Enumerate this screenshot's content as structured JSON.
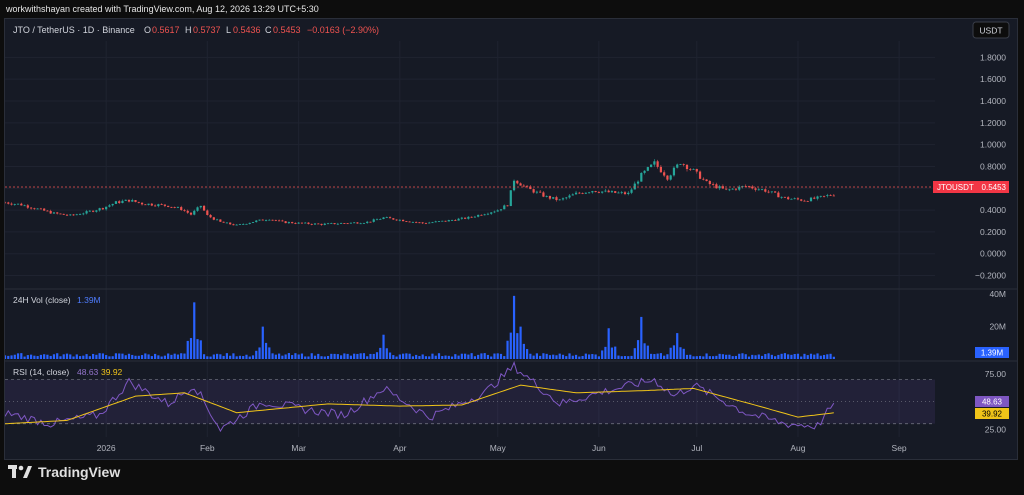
{
  "credit": "workwithshayan created with TradingView.com, Aug 12, 2026 13:29 UTC+5:30",
  "header": {
    "symbol": "JTO / TetherUS · 1D · Binance",
    "o_label": "O",
    "o": "0.5617",
    "h_label": "H",
    "h": "0.5737",
    "l_label": "L",
    "l": "0.5436",
    "c_label": "C",
    "c": "0.5453",
    "change": "−0.0163 (−2.90%)"
  },
  "currency_button": "USDT",
  "volume_pane": {
    "label": "24H Vol (close)",
    "value": "1.39M",
    "badge": "1.39M"
  },
  "rsi_pane": {
    "label": "RSI (14, close)",
    "rsi": "48.63",
    "ma": "39.92"
  },
  "price_badge": {
    "name": "JTOUSDT",
    "value": "0.5453"
  },
  "footer": {
    "brand": "TradingView"
  },
  "colors": {
    "up": "#26a69a",
    "down": "#ef5350",
    "volume": "#2962ff",
    "rsi": "#7e57c2",
    "rsi_ma": "#f0c419",
    "badge_red": "#f23645"
  },
  "chart_data": [
    {
      "type": "candlestick",
      "title": "JTO / TetherUS · 1D · Binance",
      "y_ticks": [
        "1.8000",
        "1.6000",
        "1.4000",
        "1.2000",
        "1.0000",
        "0.8000",
        "0.6000",
        "0.4000",
        "0.2000",
        "0.0000",
        "−0.2000"
      ],
      "x_ticks": [
        {
          "label": "2026",
          "date": "2026-01-01"
        },
        {
          "label": "Feb",
          "date": "2026-02-01"
        },
        {
          "label": "Mar",
          "date": "2026-03-01"
        },
        {
          "label": "Apr",
          "date": "2026-04-01"
        },
        {
          "label": "May",
          "date": "2026-05-01"
        },
        {
          "label": "Jun",
          "date": "2026-06-01"
        },
        {
          "label": "Jul",
          "date": "2026-07-01"
        },
        {
          "label": "Aug",
          "date": "2026-08-01"
        },
        {
          "label": "Sep",
          "date": "2026-09-01"
        }
      ],
      "ylim": [
        -0.25,
        1.95
      ],
      "date_range": [
        "2025-12-01",
        "2026-08-12"
      ],
      "close_points": [
        [
          "2025-12-01",
          0.47
        ],
        [
          "2025-12-06",
          0.45
        ],
        [
          "2025-12-11",
          0.41
        ],
        [
          "2025-12-16",
          0.37
        ],
        [
          "2025-12-21",
          0.35
        ],
        [
          "2025-12-26",
          0.38
        ],
        [
          "2025-12-31",
          0.42
        ],
        [
          "2026-01-04",
          0.47
        ],
        [
          "2026-01-08",
          0.49
        ],
        [
          "2026-01-12",
          0.46
        ],
        [
          "2026-01-16",
          0.45
        ],
        [
          "2026-01-20",
          0.44
        ],
        [
          "2026-01-24",
          0.41
        ],
        [
          "2026-01-27",
          0.36
        ],
        [
          "2026-01-30",
          0.44
        ],
        [
          "2026-02-01",
          0.35
        ],
        [
          "2026-02-05",
          0.29
        ],
        [
          "2026-02-10",
          0.26
        ],
        [
          "2026-02-16",
          0.3
        ],
        [
          "2026-02-20",
          0.32
        ],
        [
          "2026-02-24",
          0.29
        ],
        [
          "2026-03-01",
          0.28
        ],
        [
          "2026-03-08",
          0.27
        ],
        [
          "2026-03-15",
          0.28
        ],
        [
          "2026-03-22",
          0.29
        ],
        [
          "2026-03-27",
          0.33
        ],
        [
          "2026-04-01",
          0.31
        ],
        [
          "2026-04-08",
          0.28
        ],
        [
          "2026-04-15",
          0.3
        ],
        [
          "2026-04-22",
          0.33
        ],
        [
          "2026-04-27",
          0.37
        ],
        [
          "2026-05-01",
          0.4
        ],
        [
          "2026-05-04",
          0.45
        ],
        [
          "2026-05-06",
          0.68
        ],
        [
          "2026-05-10",
          0.6
        ],
        [
          "2026-05-16",
          0.52
        ],
        [
          "2026-05-20",
          0.49
        ],
        [
          "2026-05-25",
          0.55
        ],
        [
          "2026-05-30",
          0.58
        ],
        [
          "2026-06-05",
          0.56
        ],
        [
          "2026-06-10",
          0.55
        ],
        [
          "2026-06-14",
          0.72
        ],
        [
          "2026-06-18",
          0.83
        ],
        [
          "2026-06-22",
          0.7
        ],
        [
          "2026-06-26",
          0.84
        ],
        [
          "2026-06-30",
          0.76
        ],
        [
          "2026-07-04",
          0.65
        ],
        [
          "2026-07-10",
          0.58
        ],
        [
          "2026-07-16",
          0.62
        ],
        [
          "2026-07-22",
          0.58
        ],
        [
          "2026-07-28",
          0.51
        ],
        [
          "2026-08-03",
          0.49
        ],
        [
          "2026-08-07",
          0.51
        ],
        [
          "2026-08-12",
          0.5453
        ]
      ]
    },
    {
      "type": "bar",
      "title": "24H Vol (close)",
      "y_ticks": [
        "40M",
        "20M"
      ],
      "ylim": [
        0,
        42
      ],
      "unit": "M",
      "spikes": [
        [
          "2026-01-28",
          35
        ],
        [
          "2026-02-18",
          20
        ],
        [
          "2026-03-27",
          15
        ],
        [
          "2026-05-06",
          39
        ],
        [
          "2026-05-08",
          20
        ],
        [
          "2026-06-04",
          19
        ],
        [
          "2026-06-14",
          26
        ],
        [
          "2026-06-25",
          16
        ]
      ],
      "latest": 1.39
    },
    {
      "type": "line",
      "title": "RSI (14, close)",
      "y_ticks": [
        "75.00",
        "25.00"
      ],
      "ylim": [
        18,
        85
      ],
      "bands": [
        70,
        50,
        30
      ],
      "series": [
        {
          "name": "RSI",
          "points": [
            [
              "2025-12-01",
              40
            ],
            [
              "2025-12-15",
              30
            ],
            [
              "2025-12-30",
              38
            ],
            [
              "2026-01-08",
              68
            ],
            [
              "2026-01-20",
              48
            ],
            [
              "2026-01-28",
              65
            ],
            [
              "2026-02-05",
              25
            ],
            [
              "2026-02-18",
              50
            ],
            [
              "2026-03-05",
              42
            ],
            [
              "2026-03-15",
              38
            ],
            [
              "2026-03-27",
              62
            ],
            [
              "2026-04-10",
              36
            ],
            [
              "2026-04-27",
              58
            ],
            [
              "2026-05-06",
              82
            ],
            [
              "2026-05-20",
              48
            ],
            [
              "2026-06-01",
              58
            ],
            [
              "2026-06-18",
              70
            ],
            [
              "2026-06-24",
              55
            ],
            [
              "2026-06-30",
              65
            ],
            [
              "2026-07-16",
              40
            ],
            [
              "2026-07-28",
              30
            ],
            [
              "2026-08-07",
              28
            ],
            [
              "2026-08-12",
              48.63
            ]
          ]
        },
        {
          "name": "RSI MA",
          "points": [
            [
              "2025-12-01",
              30
            ],
            [
              "2025-12-20",
              33
            ],
            [
              "2026-01-10",
              55
            ],
            [
              "2026-01-25",
              58
            ],
            [
              "2026-02-10",
              40
            ],
            [
              "2026-03-10",
              48
            ],
            [
              "2026-04-01",
              46
            ],
            [
              "2026-04-20",
              47
            ],
            [
              "2026-05-08",
              65
            ],
            [
              "2026-05-25",
              58
            ],
            [
              "2026-06-15",
              60
            ],
            [
              "2026-06-30",
              62
            ],
            [
              "2026-07-20",
              46
            ],
            [
              "2026-08-01",
              36
            ],
            [
              "2026-08-12",
              39.92
            ]
          ]
        }
      ]
    }
  ]
}
